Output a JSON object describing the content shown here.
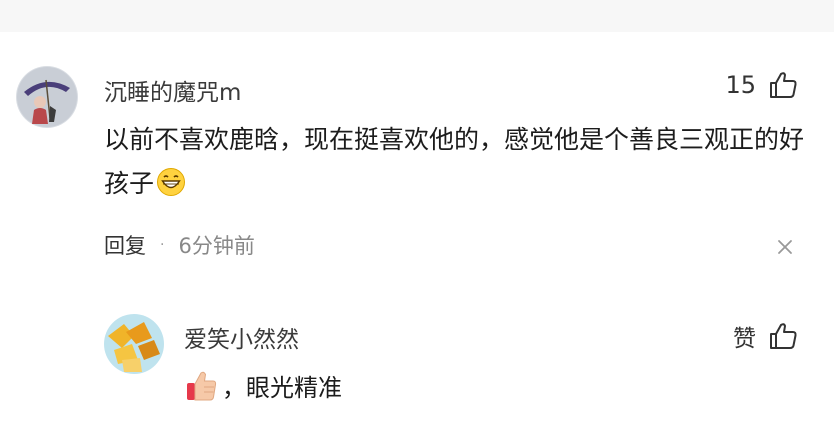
{
  "comments": [
    {
      "username": "沉睡的魔咒m",
      "like_count": "15",
      "text": "以前不喜欢鹿晗，现在挺喜欢他的，感觉他是个善良三观正的好孩子",
      "emoji": "grinning-face-emoji",
      "reply_label": "回复",
      "meta_dot": "·",
      "timestamp": "6分钟前"
    },
    {
      "username": "爱笑小然然",
      "like_label": "赞",
      "emoji": "thumbs-up-emoji",
      "text": "，眼光精准"
    }
  ],
  "icons": {
    "like": "thumbs-up-outline-icon",
    "close": "close-icon"
  },
  "colors": {
    "text": "#1c1c1c",
    "muted": "#888888",
    "top_strip": "#f7f7f7"
  }
}
